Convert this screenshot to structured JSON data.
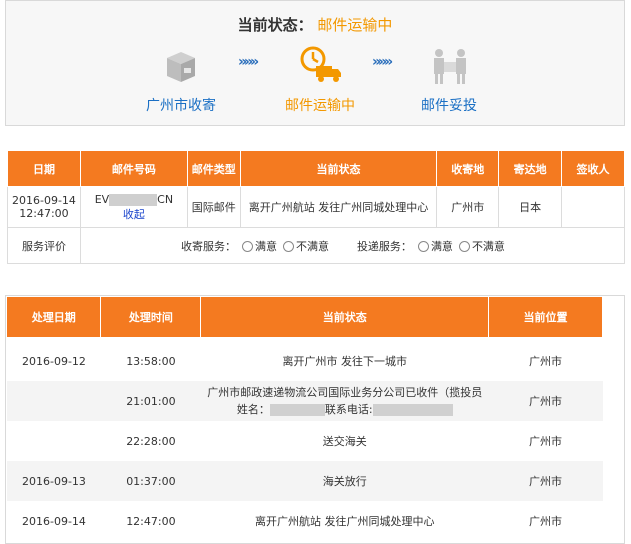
{
  "status": {
    "label": "当前状态：",
    "value": "邮件运输中",
    "steps": [
      {
        "label": "广州市收寄",
        "icon": "box-icon"
      },
      {
        "label": "邮件运输中",
        "icon": "truck-clock-icon"
      },
      {
        "label": "邮件妥投",
        "icon": "delivery-person-icon"
      }
    ],
    "arrow": "»»»"
  },
  "mail_table": {
    "headers": [
      "日期",
      "邮件号码",
      "邮件类型",
      "当前状态",
      "收寄地",
      "寄达地",
      "签收人"
    ],
    "row": {
      "date": "2016-09-14 12:47:00",
      "number_prefix": "EV",
      "number_suffix": "CN",
      "collapse": "收起",
      "type": "国际邮件",
      "status": "离开广州航站 发往广州同城处理中心",
      "origin": "广州市",
      "destination": "日本",
      "signer": ""
    },
    "rating": {
      "label": "服务评价",
      "collect_label": "收寄服务：",
      "deliver_label": "投递服务：",
      "satisfied": "满意",
      "unsatisfied": "不满意"
    }
  },
  "track_table": {
    "headers": [
      "处理日期",
      "处理时间",
      "当前状态",
      "当前位置"
    ],
    "rows": [
      {
        "date": "2016-09-12",
        "time": "13:58:00",
        "status": "离开广州市 发往下一城市",
        "location": "广州市"
      },
      {
        "date": "",
        "time": "21:01:00",
        "status_a": "广州市邮政速递物流公司国际业务分公司已收件（揽投员姓名：",
        "status_b": "联系电话:",
        "location": "广州市"
      },
      {
        "date": "",
        "time": "22:28:00",
        "status": "送交海关",
        "location": "广州市"
      },
      {
        "date": "2016-09-13",
        "time": "01:37:00",
        "status": "海关放行",
        "location": "广州市"
      },
      {
        "date": "2016-09-14",
        "time": "12:47:00",
        "status": "离开广州航站 发往广州同城处理中心",
        "location": "广州市"
      }
    ]
  },
  "colors": {
    "accent": "#f47a20",
    "link": "#1a6fc4",
    "highlight": "#f39800"
  }
}
